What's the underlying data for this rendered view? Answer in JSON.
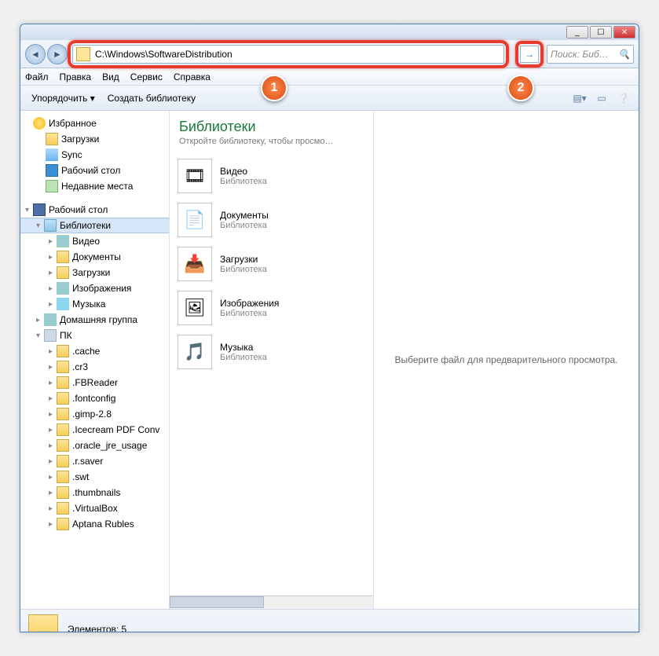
{
  "titlebar": {
    "min": "_",
    "max": "☐",
    "close": "✕"
  },
  "nav": {
    "address": "C:\\Windows\\SoftwareDistribution",
    "search_placeholder": "Поиск: Биб…"
  },
  "menu": {
    "file": "Файл",
    "edit": "Правка",
    "view": "Вид",
    "tools": "Сервис",
    "help": "Справка"
  },
  "toolbar": {
    "organize": "Упорядочить ▾",
    "newlib": "Создать библиотеку"
  },
  "sidebar": {
    "fav_header": "Избранное",
    "fav": [
      {
        "label": "Загрузки",
        "icon": "ic-folder"
      },
      {
        "label": "Sync",
        "icon": "ic-sync"
      },
      {
        "label": "Рабочий стол",
        "icon": "ic-desktop"
      },
      {
        "label": "Недавние места",
        "icon": "ic-clock"
      }
    ],
    "desktop_header": "Рабочий стол",
    "libs_header": "Библиотеки",
    "libs": [
      {
        "label": "Видео",
        "icon": "ic-media"
      },
      {
        "label": "Документы",
        "icon": "ic-folder"
      },
      {
        "label": "Загрузки",
        "icon": "ic-folder"
      },
      {
        "label": "Изображения",
        "icon": "ic-media"
      },
      {
        "label": "Музыка",
        "icon": "ic-note"
      }
    ],
    "homegroup": "Домашняя группа",
    "pc_header": "ПК",
    "pc": [
      ".cache",
      ".cr3",
      ".FBReader",
      ".fontconfig",
      ".gimp-2.8",
      ".Icecream PDF Conv",
      ".oracle_jre_usage",
      ".r.saver",
      ".swt",
      ".thumbnails",
      ".VirtualBox",
      "Aptana Rubles"
    ]
  },
  "folderview": {
    "title": "Библиотеки",
    "subtitle": "Откройте библиотеку, чтобы просмо…",
    "item_sub": "Библиотека",
    "items": [
      {
        "name": "Видео",
        "glyph": "🎞"
      },
      {
        "name": "Документы",
        "glyph": "📄"
      },
      {
        "name": "Загрузки",
        "glyph": "📥"
      },
      {
        "name": "Изображения",
        "glyph": "🖼"
      },
      {
        "name": "Музыка",
        "glyph": "🎵"
      }
    ]
  },
  "preview": {
    "text": "Выберите файл для предварительного просмотра."
  },
  "status": {
    "label": "Элементов:",
    "count": "5"
  },
  "callouts": {
    "one": "1",
    "two": "2"
  }
}
